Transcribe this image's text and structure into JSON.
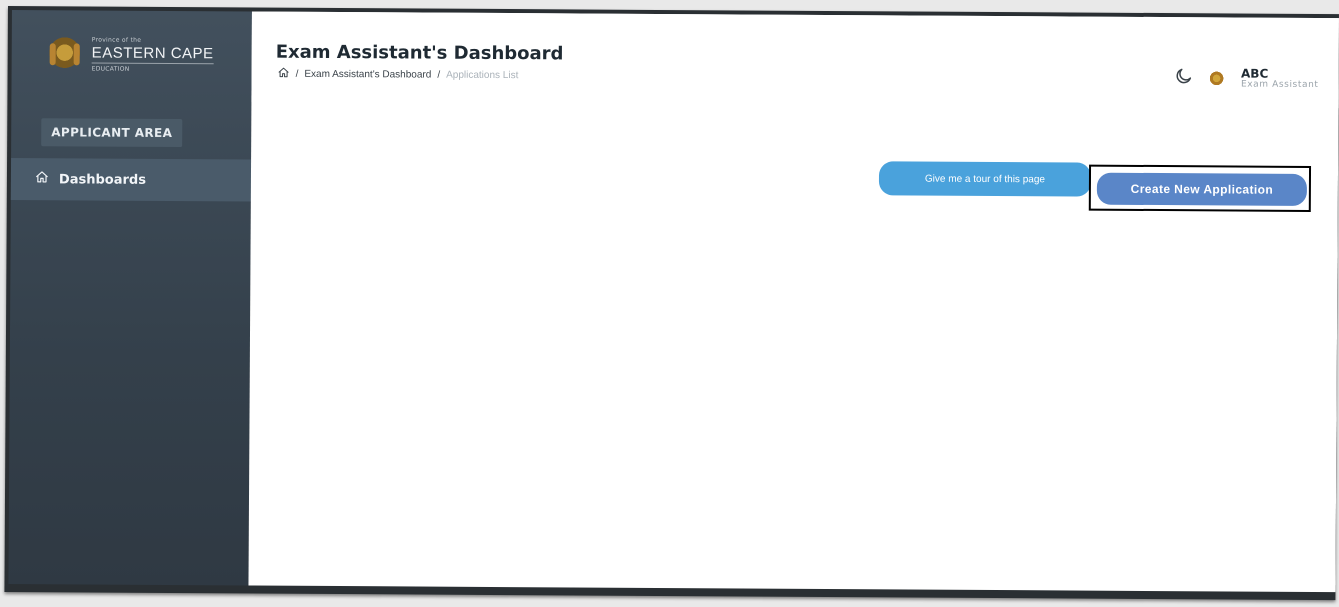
{
  "brand": {
    "top": "Province of the",
    "main": "EASTERN CAPE",
    "sub": "EDUCATION"
  },
  "sidebar": {
    "section_label": "APPLICANT AREA",
    "items": [
      {
        "label": "Dashboards",
        "icon": "home-icon"
      }
    ]
  },
  "header": {
    "title": "Exam Assistant's Dashboard",
    "breadcrumb": [
      {
        "label": "Exam Assistant's Dashboard"
      },
      {
        "label": "Applications List"
      }
    ],
    "user": {
      "name": "ABC",
      "role": "Exam Assistant"
    }
  },
  "actions": {
    "tour_label": "Give me a tour of this page",
    "create_label": "Create New Application"
  },
  "colors": {
    "sidebar": "#3b4752",
    "tour_button": "#4aa2dc",
    "create_button": "#5a86c8"
  }
}
